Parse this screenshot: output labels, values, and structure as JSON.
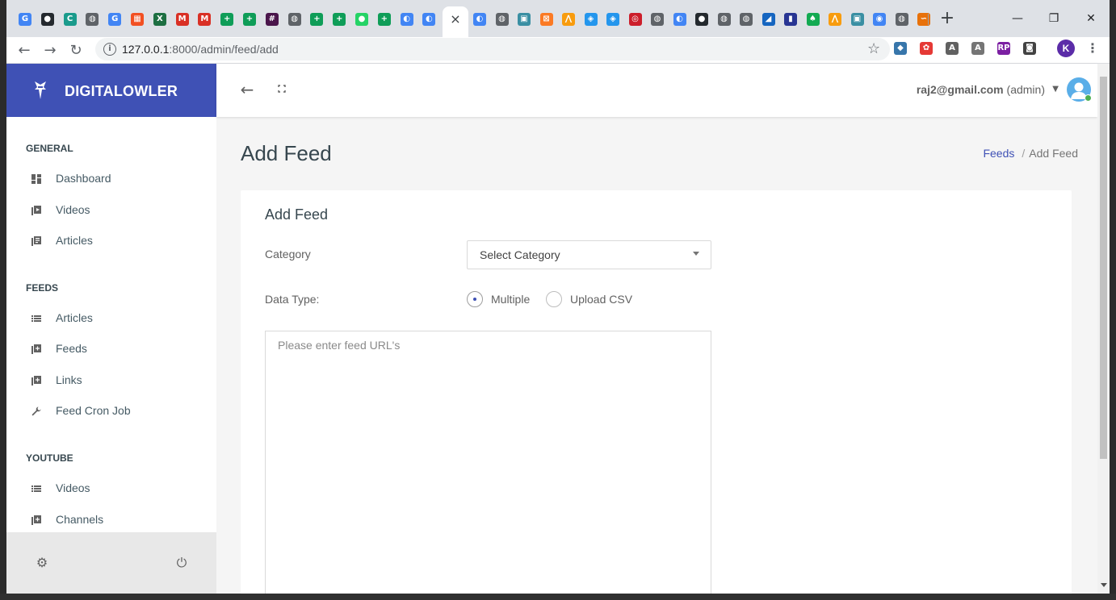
{
  "browser": {
    "url_host": "127.0.0.1",
    "url_path": ":8000/admin/feed/add",
    "profile_initial": "K",
    "new_tab_label": "+",
    "tab_icons": [
      {
        "name": "google-icon",
        "glyph": "G",
        "color": "#4285f4"
      },
      {
        "name": "github-icon",
        "glyph": "●",
        "color": "#24292e"
      },
      {
        "name": "c-icon",
        "glyph": "C",
        "color": "#1a9b8c"
      },
      {
        "name": "globe-icon",
        "glyph": "◍",
        "color": "#5f6368"
      },
      {
        "name": "translate-icon",
        "glyph": "G",
        "color": "#4285f4"
      },
      {
        "name": "microsoft-icon",
        "glyph": "▦",
        "color": "#f25022"
      },
      {
        "name": "excel-icon",
        "glyph": "X",
        "color": "#1d6f42"
      },
      {
        "name": "gmail-icon",
        "glyph": "M",
        "color": "#d93025"
      },
      {
        "name": "gmail-icon",
        "glyph": "M",
        "color": "#d93025"
      },
      {
        "name": "tab-plus-icon",
        "glyph": "+",
        "color": "#0f9d58"
      },
      {
        "name": "tab-plus-icon",
        "glyph": "+",
        "color": "#0f9d58"
      },
      {
        "name": "slack-icon",
        "glyph": "#",
        "color": "#4a154b"
      },
      {
        "name": "globe-icon",
        "glyph": "◍",
        "color": "#5f6368"
      },
      {
        "name": "tab-plus-icon",
        "glyph": "+",
        "color": "#0f9d58"
      },
      {
        "name": "tab-plus-icon",
        "glyph": "+",
        "color": "#0f9d58"
      },
      {
        "name": "whatsapp-icon",
        "glyph": "●",
        "color": "#25d366"
      },
      {
        "name": "tab-plus-icon",
        "glyph": "+",
        "color": "#0f9d58"
      },
      {
        "name": "moon-icon",
        "glyph": "◐",
        "color": "#4285f4"
      },
      {
        "name": "moon-icon",
        "glyph": "◐",
        "color": "#4285f4"
      }
    ],
    "tab_icons_right": [
      {
        "name": "moon-icon",
        "glyph": "◐",
        "color": "#4285f4"
      },
      {
        "name": "globe-icon",
        "glyph": "◍",
        "color": "#5f6368"
      },
      {
        "name": "image-icon",
        "glyph": "▣",
        "color": "#3a8fa3"
      },
      {
        "name": "xampp-icon",
        "glyph": "⊠",
        "color": "#fb7a24"
      },
      {
        "name": "phpmyadmin-icon",
        "glyph": "⋀",
        "color": "#f89c0e"
      },
      {
        "name": "docker-icon",
        "glyph": "◈",
        "color": "#2496ed"
      },
      {
        "name": "docker-icon",
        "glyph": "◈",
        "color": "#2496ed"
      },
      {
        "name": "opera-icon",
        "glyph": "◎",
        "color": "#cc1e2b"
      },
      {
        "name": "globe-icon",
        "glyph": "◍",
        "color": "#5f6368"
      },
      {
        "name": "moon-icon",
        "glyph": "◐",
        "color": "#4285f4"
      },
      {
        "name": "github-icon",
        "glyph": "●",
        "color": "#24292e"
      },
      {
        "name": "globe-icon",
        "glyph": "◍",
        "color": "#5f6368"
      },
      {
        "name": "globe-icon",
        "glyph": "◍",
        "color": "#5f6368"
      },
      {
        "name": "app-icon",
        "glyph": "◢",
        "color": "#1565c0"
      },
      {
        "name": "chart-icon",
        "glyph": "▮",
        "color": "#283593"
      },
      {
        "name": "mongodb-icon",
        "glyph": "♠",
        "color": "#13aa52"
      },
      {
        "name": "phpmyadmin-icon",
        "glyph": "⋀",
        "color": "#f89c0e"
      },
      {
        "name": "image-icon",
        "glyph": "▣",
        "color": "#3a8fa3"
      },
      {
        "name": "chrome-icon",
        "glyph": "◉",
        "color": "#4285f4"
      },
      {
        "name": "globe-icon",
        "glyph": "◍",
        "color": "#5f6368"
      },
      {
        "name": "dash-icon",
        "glyph": "∽",
        "color": "#e8710a"
      }
    ],
    "extensions": [
      {
        "name": "python-icon",
        "glyph": "◆",
        "color": "#3776ab"
      },
      {
        "name": "color-wheel-icon",
        "glyph": "✿",
        "color": "#e53935"
      },
      {
        "name": "a-extension-icon",
        "glyph": "A",
        "color": "#616161"
      },
      {
        "name": "angular-icon",
        "glyph": "A",
        "color": "#757575"
      },
      {
        "name": "rp-extension-icon",
        "glyph": "RP",
        "color": "#7b1fa2"
      },
      {
        "name": "puzzle-icon",
        "glyph": "◙",
        "color": "#424242"
      }
    ]
  },
  "brand": {
    "name": "DIGITALOWLER",
    "color": "#3f51b5"
  },
  "sidebar": {
    "sections": [
      {
        "title": "GENERAL",
        "items": [
          {
            "label": "Dashboard",
            "icon": "dashboard-icon"
          },
          {
            "label": "Videos",
            "icon": "video-library-icon"
          },
          {
            "label": "Articles",
            "icon": "library-books-icon"
          }
        ]
      },
      {
        "title": "FEEDS",
        "items": [
          {
            "label": "Articles",
            "icon": "list-icon"
          },
          {
            "label": "Feeds",
            "icon": "library-add-icon"
          },
          {
            "label": "Links",
            "icon": "library-add-icon"
          },
          {
            "label": "Feed Cron Job",
            "icon": "wrench-icon"
          }
        ]
      },
      {
        "title": "YOUTUBE",
        "items": [
          {
            "label": "Videos",
            "icon": "list-icon"
          },
          {
            "label": "Channels",
            "icon": "library-add-icon"
          }
        ]
      }
    ]
  },
  "header": {
    "user_email": "raj2@gmail.com",
    "user_role": "(admin)"
  },
  "page": {
    "title": "Add Feed",
    "breadcrumb": {
      "parent": "Feeds",
      "current": "Add Feed"
    }
  },
  "form": {
    "card_title": "Add Feed",
    "category_label": "Category",
    "category_value": "Select Category",
    "data_type_label": "Data Type:",
    "data_type_options": [
      "Multiple",
      "Upload CSV"
    ],
    "data_type_selected": "Multiple",
    "urls_placeholder": "Please enter feed URL's"
  }
}
